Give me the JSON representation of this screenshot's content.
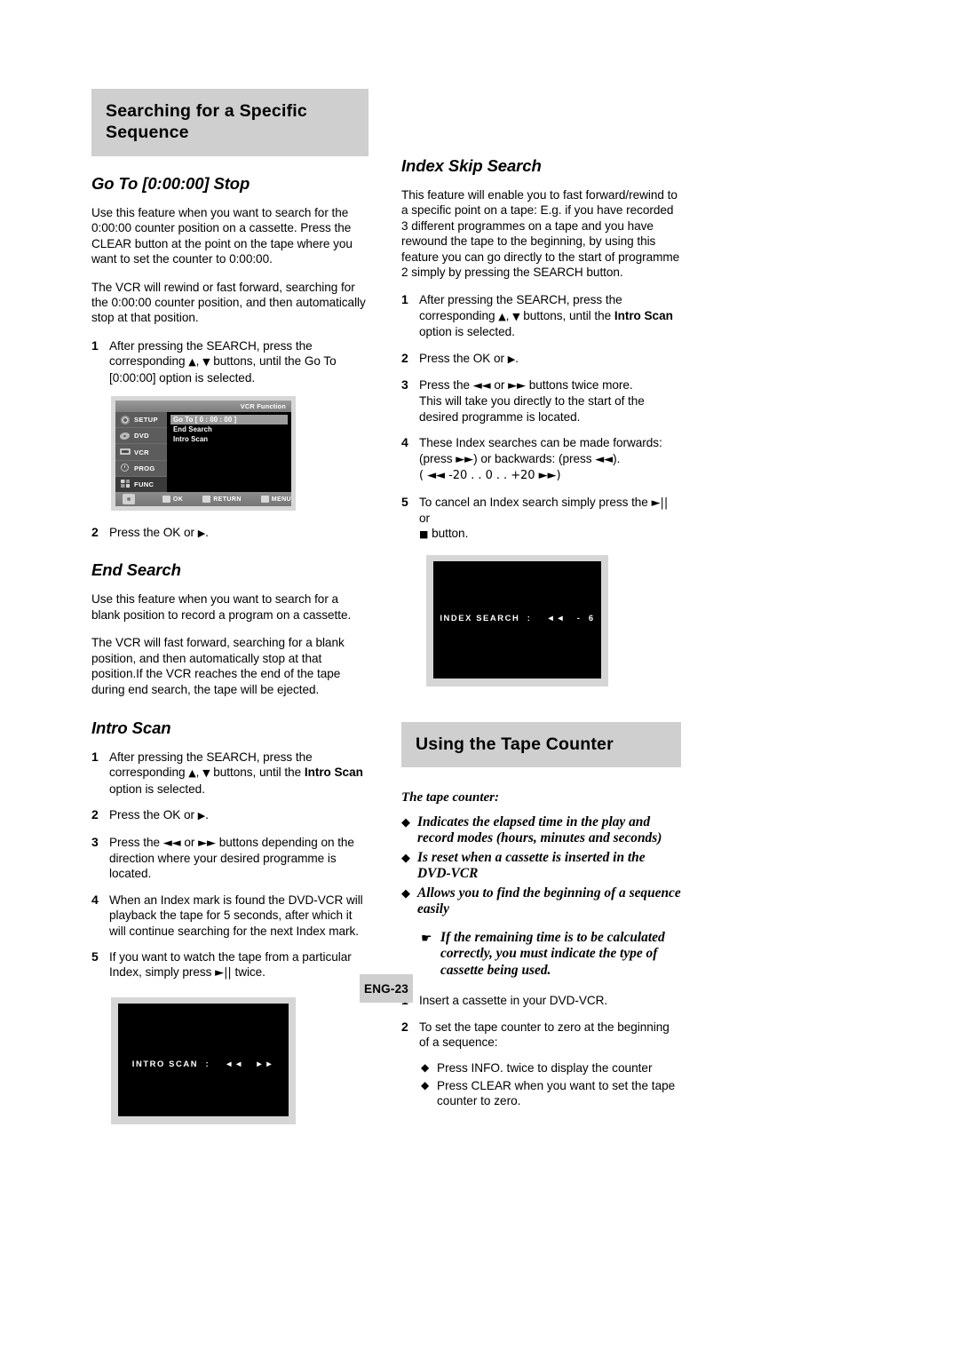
{
  "page": {
    "badge": "ENG-23"
  },
  "left": {
    "section_title": "Searching for a Specific Sequence",
    "goto": {
      "heading": "Go To [0:00:00] Stop",
      "para1": "Use this feature when you want to search for the 0:00:00 counter position on a cassette. Press the CLEAR button at the point on the tape where you want to set the counter to 0:00:00.",
      "para2": "The VCR will rewind or fast forward, searching for the 0:00:00 counter position, and then automatically stop at that position.",
      "step1_num": "1",
      "step1_a": "After pressing the SEARCH, press the corresponding ",
      "step1_b": " buttons, until the Go To [0:00:00] option is selected.",
      "step2_num": "2",
      "step2": "Press the OK or "
    },
    "vcr_menu": {
      "title": "VCR Function",
      "side_items": [
        {
          "label": "SETUP",
          "icon": "gear-icon"
        },
        {
          "label": "DVD",
          "icon": "disc-icon"
        },
        {
          "label": "VCR",
          "icon": "tape-icon"
        },
        {
          "label": "PROG",
          "icon": "clock-icon"
        },
        {
          "label": "FUNC",
          "icon": "func-icon"
        }
      ],
      "rows": [
        "Go To [ 0 : 00 : 00 ]",
        "End Search",
        "Intro Scan"
      ],
      "bottom": {
        "nav": "",
        "ok": "OK",
        "return": "RETURN",
        "menu": "MENU"
      }
    },
    "end_search": {
      "heading": "End Search",
      "para1": "Use this feature when you want to search for a blank position to record a program on a cassette.",
      "para2": "The VCR will fast forward, searching for a blank position, and then automatically stop at that position.If the VCR reaches the end of the tape during end search, the tape will be ejected."
    },
    "intro_scan": {
      "heading": "Intro Scan",
      "step1_num": "1",
      "step1_a": "After pressing the SEARCH, press the corresponding ",
      "step1_mid": " buttons, until the ",
      "step1_bold": "Intro Scan",
      "step1_end": " option is selected.",
      "step2_num": "2",
      "step2": "Press the OK or ",
      "step3_num": "3",
      "step3_a": "Press the ",
      "step3_b": " or ",
      "step3_c": " buttons depending on the direction where your desired programme is located.",
      "step4_num": "4",
      "step4": "When an Index mark is found the DVD-VCR will playback the tape for 5 seconds, after which it will continue searching for the next Index mark.",
      "step5_num": "5",
      "step5_a": "If you want to watch the tape from a particular Index, simply press ",
      "step5_b": " twice."
    },
    "intro_scan_screen": {
      "text": "INTRO SCAN  :    ◄◄   ►►"
    }
  },
  "right": {
    "index_skip": {
      "heading": "Index Skip Search",
      "para1": "This feature will enable you to fast forward/rewind to a specific point on a tape:  E.g. if you have recorded 3 different programmes on a tape and you have rewound the tape to the beginning, by using this feature you can go directly to the start of programme 2 simply by pressing the SEARCH button.",
      "step1_num": "1",
      "step1_a": "After pressing the SEARCH, press the corresponding ",
      "step1_mid": " buttons, until the ",
      "step1_bold": "Intro Scan",
      "step1_end": " option is selected.",
      "step2_num": "2",
      "step2": "Press the OK or ",
      "step3_num": "3",
      "step3_a": "Press the ",
      "step3_b": " or ",
      "step3_c": " buttons twice more.",
      "step3_d": "This will take you directly to the start of the desired programme is located.",
      "step4_num": "4",
      "step4_a": "These Index searches can be made forwards: (press ",
      "step4_b": ") or backwards: (press ",
      "step4_c": ").",
      "step4_range": "( ◄◄ -20  .   .  0  .   .  +20 ►►)",
      "step5_num": "5",
      "step5_a": "To cancel an Index search simply press the ",
      "step5_b": " or ",
      "step5_c": " button."
    },
    "index_search_screen": {
      "text": "INDEX SEARCH  :    ◄◄   -  6"
    },
    "tape_counter": {
      "section_title": "Using the Tape Counter",
      "lead": "The tape counter:",
      "bullets": [
        "Indicates the elapsed time in the play and record modes (hours, minutes and seconds)",
        "Is reset when a cassette is inserted in the DVD-VCR",
        "Allows you to find the beginning of a sequence easily"
      ],
      "note": "If the remaining time is to be calculated correctly, you must indicate the type of cassette being used.",
      "step1_num": "1",
      "step1": "Insert a cassette in your DVD-VCR.",
      "step2_num": "2",
      "step2": "To set the tape counter to zero at the beginning of a sequence:",
      "sub_bullets": [
        "Press INFO. twice to display the counter",
        "Press CLEAR when you want to set the tape counter to zero."
      ]
    }
  },
  "symbols": {
    "up": "▲",
    "down": "▼",
    "right": "▶",
    "rew": "◄◄",
    "ff": "►►",
    "playpause": "►||",
    "stop": "■",
    "diamond": "◆",
    "hand": "☛"
  }
}
